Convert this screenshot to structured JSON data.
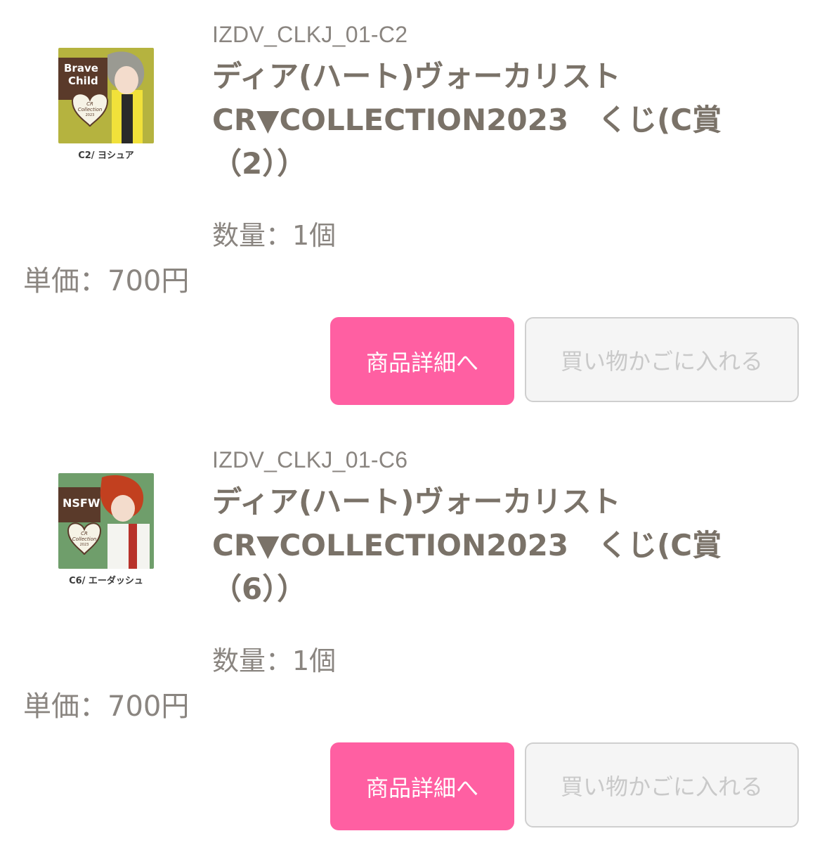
{
  "items": [
    {
      "code": "IZDV_CLKJ_01-C2",
      "title_lines": [
        "ディア(ハート)ヴォーカリスト",
        "CR▼COLLECTION2023　くじ(C賞",
        "（2））"
      ],
      "thumb_caption": "C2/ ヨシュア",
      "thumb_text": [
        "Brave",
        "Child",
        "CR",
        "Collection",
        "2023"
      ],
      "qty": "数量：1個",
      "price": "単価：700円",
      "detail_button": "商品詳細へ",
      "cart_button": "買い物かごに入れる",
      "thumb_bg": "#b5b33f"
    },
    {
      "code": "IZDV_CLKJ_01-C6",
      "title_lines": [
        "ディア(ハート)ヴォーカリスト",
        "CR▼COLLECTION2023　くじ(C賞",
        "（6））"
      ],
      "thumb_caption": "C6/ エーダッシュ",
      "thumb_text": [
        "NSFW",
        "CR",
        "Collection",
        "2023"
      ],
      "qty": "数量：1個",
      "price": "単価：700円",
      "detail_button": "商品詳細へ",
      "cart_button": "買い物かごに入れる",
      "thumb_bg": "#6f9e6b"
    }
  ],
  "colors": {
    "accent_pink": "#ff5fa2",
    "text_gray": "#7a7268",
    "disabled_text": "#c9c9c9"
  }
}
